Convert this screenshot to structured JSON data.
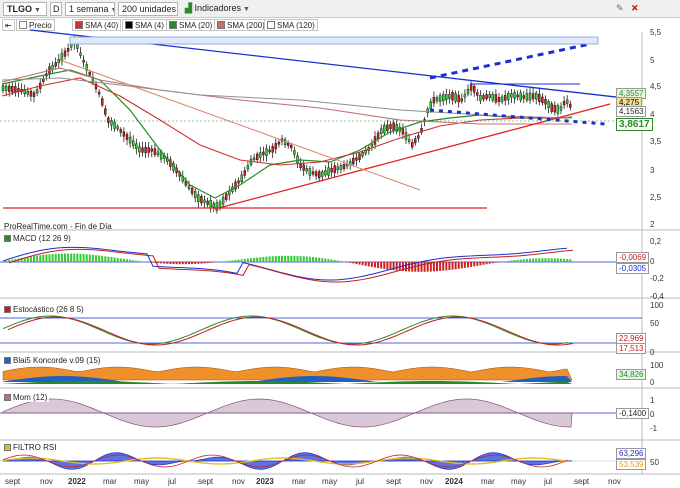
{
  "toolbar": {
    "symbol": "TLGO",
    "d_label": "D",
    "period": "1 semana",
    "units": "200 unidades",
    "indicators": "Indicadores",
    "price_label": "Precio",
    "sma40": "SMA (40)",
    "sma4": "SMA (4)",
    "sma20": "SMA (20)",
    "sma200": "SMA (200)",
    "sma120": "SMA (120)",
    "close_icon": "close-icon",
    "settings_icon": "wrench-icon"
  },
  "colors": {
    "sma40": "#d03030",
    "sma4": "#000000",
    "sma20": "#2a8a2a",
    "sma200": "#c07070",
    "sma120": "#909090",
    "up": "#33cc33",
    "down": "#cc2222",
    "trend_blue": "#1b2fd0",
    "support_red": "#e02020"
  },
  "source": "ProRealTime.com - Fin de Día",
  "price_axis": {
    "ticks": [
      "5,5",
      "5",
      "4,5",
      "4",
      "3,5",
      "3",
      "2,5",
      "2"
    ],
    "tag_upper1": "4,3557",
    "tag_upper2": "4,275",
    "tag_upper3": "4,1563",
    "tag_last": "3,8617"
  },
  "panels": {
    "macd": {
      "label": "MACD (12 26 9)",
      "ticks": [
        "0,2",
        "0",
        "-0,2",
        "-0,4"
      ],
      "tag1": "-0,0069",
      "tag2": "-0,0305"
    },
    "stoch": {
      "label": "Estocástico (26 8 5)",
      "ticks": [
        "100",
        "50",
        "0"
      ],
      "tag1": "22,969",
      "tag2": "17,513"
    },
    "koncorde": {
      "label": "Blai5 Koncorde v.09 (15)",
      "ticks": [
        "100",
        "0"
      ],
      "tag1": "34,826"
    },
    "mom": {
      "label": "Mom (12)",
      "ticks": [
        "1",
        "0",
        "-1"
      ],
      "tag1": "-0,1400"
    },
    "rsi": {
      "label": "FILTRO RSI",
      "ticks": [
        "50"
      ],
      "tag1": "63,296",
      "tag2": "53,539"
    }
  },
  "x_axis": {
    "labels": [
      "sept",
      "nov",
      "2022",
      "mar",
      "may",
      "jul",
      "sept",
      "nov",
      "2023",
      "mar",
      "may",
      "jul",
      "sept",
      "nov",
      "2024",
      "mar",
      "may",
      "jul",
      "sept",
      "nov"
    ],
    "years": [
      "2022",
      "2023",
      "2024"
    ]
  }
}
